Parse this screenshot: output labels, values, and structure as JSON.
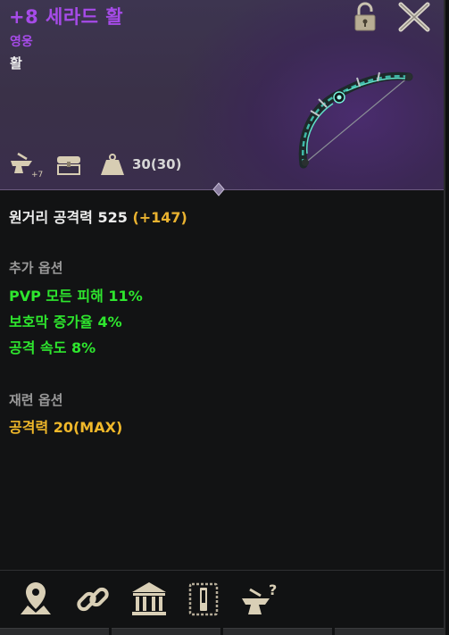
{
  "item": {
    "name": "+8 세라드 활",
    "grade": "영웅",
    "type": "활"
  },
  "header_stats": {
    "durability": "30(30)"
  },
  "attack": {
    "label": "원거리 공격력 525",
    "bonus": "(+147)"
  },
  "extra_options": {
    "title": "추가 옵션",
    "lines": [
      "PVP 모든 피해 11%",
      "보호막 증가율 4%",
      "공격 속도 8%"
    ]
  },
  "refine_options": {
    "title": "재련 옵션",
    "lines": [
      "공격력 20(MAX)"
    ]
  },
  "colors": {
    "grade_heroic": "#a64be8",
    "option_green": "#2ee62e",
    "refine_gold": "#f0b82a"
  },
  "icons": {
    "header": [
      "lock-open-icon",
      "close-icon",
      "enchant-anvil-icon",
      "chest-icon",
      "weight-icon"
    ],
    "footer": [
      "location-pin-icon",
      "link-icon",
      "bank-icon",
      "tag-icon",
      "anvil-question-icon"
    ]
  }
}
